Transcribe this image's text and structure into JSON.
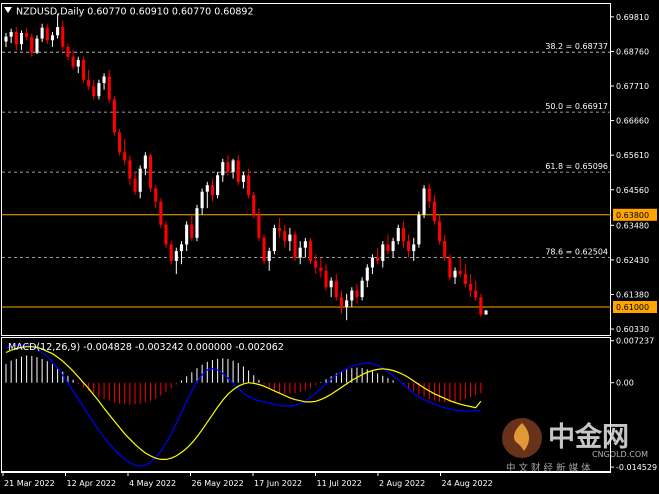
{
  "header": {
    "symbol_line": "NZDUSD,Daily  0.60770 0.60910 0.60770 0.60892",
    "icon": "collapse-triangle-icon"
  },
  "colors": {
    "background": "#000000",
    "bull": "#ffffff",
    "bear": "#ff0000",
    "level_line": "#ffa500",
    "grid": "#ffffff",
    "macd_hist_pos": "#ffffff",
    "macd_hist_neg": "#ff0000",
    "macd_main": "#0000ff",
    "macd_signal": "#ffff00"
  },
  "chart_data": [
    {
      "type": "candlestick",
      "title": "NZDUSD,Daily",
      "ohlc_last": {
        "open": 0.6077,
        "high": 0.6091,
        "low": 0.6077,
        "close": 0.60892
      },
      "ylim": [
        0.6015,
        0.702
      ],
      "y_ticks": [
        "0.69810",
        "0.68760",
        "0.67710",
        "0.66660",
        "0.65610",
        "0.64560",
        "0.63480",
        "0.62430",
        "0.61380",
        "0.60330"
      ],
      "x_ticks": [
        "21 Mar 2022",
        "12 Apr 2022",
        "4 May 2022",
        "26 May 2022",
        "17 Jun 2022",
        "11 Jul 2022",
        "2 Aug 2022",
        "24 Aug 2022"
      ],
      "fib_levels": [
        {
          "label": "38.2 = 0.68737",
          "value": 0.68737
        },
        {
          "label": "50.0 = 0.66917",
          "value": 0.66917
        },
        {
          "label": "61.8 = 0.65096",
          "value": 0.65096
        },
        {
          "label": "78.6 = 0.62504",
          "value": 0.62504
        }
      ],
      "price_levels": [
        {
          "label": "0.63800",
          "value": 0.638
        },
        {
          "label": "0.61000",
          "value": 0.61
        }
      ],
      "current_price_label": "0.60892",
      "candles": [
        [
          0.6906,
          0.6932,
          0.6889,
          0.6921
        ],
        [
          0.6921,
          0.6945,
          0.6901,
          0.6935
        ],
        [
          0.6935,
          0.695,
          0.688,
          0.6898
        ],
        [
          0.6898,
          0.694,
          0.688,
          0.6932
        ],
        [
          0.6932,
          0.6948,
          0.691,
          0.692
        ],
        [
          0.692,
          0.693,
          0.686,
          0.6872
        ],
        [
          0.6872,
          0.6925,
          0.6868,
          0.6915
        ],
        [
          0.6915,
          0.696,
          0.6905,
          0.6948
        ],
        [
          0.6948,
          0.6958,
          0.69,
          0.691
        ],
        [
          0.691,
          0.6935,
          0.689,
          0.6925
        ],
        [
          0.6925,
          0.699,
          0.6915,
          0.695
        ],
        [
          0.695,
          0.697,
          0.688,
          0.689
        ],
        [
          0.689,
          0.69,
          0.685,
          0.686
        ],
        [
          0.686,
          0.688,
          0.682,
          0.683
        ],
        [
          0.683,
          0.686,
          0.681,
          0.685
        ],
        [
          0.685,
          0.686,
          0.678,
          0.679
        ],
        [
          0.679,
          0.682,
          0.676,
          0.677
        ],
        [
          0.677,
          0.679,
          0.673,
          0.674
        ],
        [
          0.674,
          0.679,
          0.673,
          0.678
        ],
        [
          0.678,
          0.681,
          0.676,
          0.68
        ],
        [
          0.68,
          0.682,
          0.672,
          0.673
        ],
        [
          0.673,
          0.674,
          0.662,
          0.663
        ],
        [
          0.663,
          0.664,
          0.656,
          0.657
        ],
        [
          0.657,
          0.661,
          0.653,
          0.6545
        ],
        [
          0.6545,
          0.656,
          0.647,
          0.649
        ],
        [
          0.649,
          0.651,
          0.644,
          0.645
        ],
        [
          0.645,
          0.653,
          0.643,
          0.652
        ],
        [
          0.652,
          0.657,
          0.65,
          0.656
        ],
        [
          0.656,
          0.6565,
          0.645,
          0.646
        ],
        [
          0.646,
          0.647,
          0.64,
          0.642
        ],
        [
          0.642,
          0.643,
          0.634,
          0.635
        ],
        [
          0.635,
          0.636,
          0.628,
          0.629
        ],
        [
          0.629,
          0.63,
          0.623,
          0.624
        ],
        [
          0.624,
          0.628,
          0.62,
          0.627
        ],
        [
          0.627,
          0.63,
          0.623,
          0.629
        ],
        [
          0.629,
          0.636,
          0.627,
          0.635
        ],
        [
          0.635,
          0.638,
          0.63,
          0.631
        ],
        [
          0.631,
          0.641,
          0.63,
          0.64
        ],
        [
          0.64,
          0.646,
          0.638,
          0.645
        ],
        [
          0.645,
          0.648,
          0.64,
          0.647
        ],
        [
          0.647,
          0.649,
          0.642,
          0.644
        ],
        [
          0.644,
          0.651,
          0.643,
          0.65
        ],
        [
          0.65,
          0.655,
          0.648,
          0.654
        ],
        [
          0.654,
          0.656,
          0.65,
          0.651
        ],
        [
          0.651,
          0.655,
          0.649,
          0.6545
        ],
        [
          0.6545,
          0.656,
          0.647,
          0.648
        ],
        [
          0.648,
          0.651,
          0.646,
          0.65
        ],
        [
          0.65,
          0.652,
          0.643,
          0.644
        ],
        [
          0.644,
          0.645,
          0.637,
          0.638
        ],
        [
          0.638,
          0.64,
          0.63,
          0.631
        ],
        [
          0.631,
          0.632,
          0.623,
          0.624
        ],
        [
          0.624,
          0.628,
          0.621,
          0.627
        ],
        [
          0.627,
          0.635,
          0.626,
          0.634
        ],
        [
          0.634,
          0.637,
          0.631,
          0.633
        ],
        [
          0.633,
          0.635,
          0.628,
          0.63
        ],
        [
          0.63,
          0.634,
          0.627,
          0.632
        ],
        [
          0.632,
          0.633,
          0.624,
          0.625
        ],
        [
          0.625,
          0.63,
          0.623,
          0.628
        ],
        [
          0.628,
          0.631,
          0.625,
          0.63
        ],
        [
          0.63,
          0.631,
          0.623,
          0.624
        ],
        [
          0.624,
          0.626,
          0.62,
          0.622
        ],
        [
          0.622,
          0.625,
          0.619,
          0.621
        ],
        [
          0.621,
          0.623,
          0.615,
          0.616
        ],
        [
          0.616,
          0.619,
          0.613,
          0.618
        ],
        [
          0.618,
          0.62,
          0.612,
          0.613
        ],
        [
          0.613,
          0.615,
          0.608,
          0.61
        ],
        [
          0.61,
          0.614,
          0.606,
          0.612
        ],
        [
          0.612,
          0.616,
          0.61,
          0.615
        ],
        [
          0.615,
          0.617,
          0.611,
          0.613
        ],
        [
          0.613,
          0.619,
          0.612,
          0.618
        ],
        [
          0.618,
          0.623,
          0.616,
          0.622
        ],
        [
          0.622,
          0.626,
          0.62,
          0.625
        ],
        [
          0.625,
          0.628,
          0.623,
          0.624
        ],
        [
          0.624,
          0.63,
          0.622,
          0.629
        ],
        [
          0.629,
          0.632,
          0.626,
          0.627
        ],
        [
          0.627,
          0.631,
          0.625,
          0.63
        ],
        [
          0.63,
          0.635,
          0.629,
          0.634
        ],
        [
          0.634,
          0.636,
          0.628,
          0.63
        ],
        [
          0.63,
          0.632,
          0.625,
          0.627
        ],
        [
          0.627,
          0.631,
          0.624,
          0.629
        ],
        [
          0.629,
          0.639,
          0.628,
          0.638
        ],
        [
          0.638,
          0.647,
          0.637,
          0.646
        ],
        [
          0.646,
          0.6475,
          0.64,
          0.642
        ],
        [
          0.642,
          0.644,
          0.635,
          0.636
        ],
        [
          0.636,
          0.638,
          0.629,
          0.63
        ],
        [
          0.63,
          0.632,
          0.624,
          0.625
        ],
        [
          0.625,
          0.626,
          0.618,
          0.619
        ],
        [
          0.619,
          0.622,
          0.617,
          0.621
        ],
        [
          0.621,
          0.625,
          0.619,
          0.62
        ],
        [
          0.62,
          0.623,
          0.616,
          0.617
        ],
        [
          0.617,
          0.62,
          0.613,
          0.615
        ],
        [
          0.615,
          0.618,
          0.612,
          0.613
        ],
        [
          0.613,
          0.614,
          0.607,
          0.6077
        ],
        [
          0.6077,
          0.6091,
          0.6077,
          0.60892
        ]
      ]
    },
    {
      "type": "histogram+line",
      "title": "MACD(12,26,9)",
      "header_values": "MACD(12,26,9) -0.004828 -0.003242 0.000000 -0.002062",
      "ylim": [
        -0.0152,
        0.0077
      ],
      "y_ticks": [
        "0.007237",
        "0.00",
        "-0.014529"
      ],
      "histogram": [
        0.0032,
        0.0038,
        0.0041,
        0.0045,
        0.0047,
        0.0046,
        0.0044,
        0.0041,
        0.0037,
        0.0032,
        0.0026,
        0.0019,
        0.0012,
        0.0005,
        -0.0002,
        -0.0008,
        -0.0014,
        -0.0019,
        -0.0024,
        -0.0028,
        -0.0031,
        -0.0034,
        -0.0036,
        -0.0037,
        -0.0038,
        -0.0037,
        -0.0036,
        -0.0034,
        -0.0031,
        -0.0027,
        -0.0022,
        -0.0016,
        -0.001,
        -0.0003,
        0.0004,
        0.0011,
        0.0018,
        0.0025,
        0.0031,
        0.0036,
        0.0039,
        0.0041,
        0.0042,
        0.0041,
        0.0038,
        0.0034,
        0.0028,
        0.0021,
        0.0013,
        0.0005,
        -0.0003,
        -0.0009,
        -0.0014,
        -0.0017,
        -0.0019,
        -0.0019,
        -0.0018,
        -0.0016,
        -0.0013,
        -0.0009,
        -0.0004,
        0.0001,
        0.0006,
        0.0011,
        0.0016,
        0.002,
        0.0023,
        0.0025,
        0.0026,
        0.0025,
        0.0023,
        0.002,
        0.0016,
        0.0012,
        0.0008,
        0.0004,
        0.0,
        -0.0005,
        -0.001,
        -0.0015,
        -0.002,
        -0.0024,
        -0.0028,
        -0.0031,
        -0.0033,
        -0.0034,
        -0.0034,
        -0.0033,
        -0.0031,
        -0.0028,
        -0.0025,
        -0.0021,
        -0.0018
      ],
      "macd": [
        0.006,
        0.0062,
        0.0064,
        0.0065,
        0.0064,
        0.0062,
        0.0058,
        0.0052,
        0.0045,
        0.0036,
        0.0025,
        0.0013,
        0.0,
        -0.0014,
        -0.0028,
        -0.0042,
        -0.0056,
        -0.0069,
        -0.0082,
        -0.0094,
        -0.0105,
        -0.0115,
        -0.0124,
        -0.0132,
        -0.0138,
        -0.0142,
        -0.0144,
        -0.0142,
        -0.0137,
        -0.0129,
        -0.0118,
        -0.0104,
        -0.0088,
        -0.007,
        -0.0051,
        -0.0032,
        -0.0014,
        0.0002,
        0.0014,
        0.0022,
        0.0024,
        0.0022,
        0.0016,
        0.0008,
        -0.0001,
        -0.001,
        -0.0018,
        -0.0024,
        -0.0028,
        -0.0031,
        -0.0033,
        -0.0035,
        -0.0037,
        -0.0039,
        -0.004,
        -0.004,
        -0.0039,
        -0.0036,
        -0.0031,
        -0.0025,
        -0.0018,
        -0.001,
        -0.0002,
        0.0006,
        0.0013,
        0.0019,
        0.0024,
        0.0028,
        0.0031,
        0.0033,
        0.0034,
        0.0033,
        0.003,
        0.0025,
        0.0019,
        0.0012,
        0.0005,
        -0.0003,
        -0.0011,
        -0.0018,
        -0.0024,
        -0.0029,
        -0.0033,
        -0.0037,
        -0.004,
        -0.0043,
        -0.0045,
        -0.0047,
        -0.0048,
        -0.0049,
        -0.0049,
        -0.0048,
        -0.0048
      ],
      "signal": [
        0.0052,
        0.0056,
        0.0059,
        0.0061,
        0.0062,
        0.0062,
        0.0061,
        0.0058,
        0.0054,
        0.005,
        0.0044,
        0.0037,
        0.0029,
        0.002,
        0.001,
        0.0,
        -0.001,
        -0.0021,
        -0.0032,
        -0.0044,
        -0.0055,
        -0.0066,
        -0.0077,
        -0.0088,
        -0.0097,
        -0.0106,
        -0.0114,
        -0.0121,
        -0.0126,
        -0.013,
        -0.0132,
        -0.0132,
        -0.013,
        -0.0126,
        -0.012,
        -0.0113,
        -0.0104,
        -0.0093,
        -0.0081,
        -0.0068,
        -0.0055,
        -0.0042,
        -0.003,
        -0.002,
        -0.0012,
        -0.0006,
        -0.0002,
        0.0,
        -0.0001,
        -0.0003,
        -0.0006,
        -0.001,
        -0.0014,
        -0.0018,
        -0.0022,
        -0.0026,
        -0.0029,
        -0.0031,
        -0.0033,
        -0.0033,
        -0.0032,
        -0.0029,
        -0.0025,
        -0.002,
        -0.0014,
        -0.0008,
        -0.0002,
        0.0004,
        0.0009,
        0.0014,
        0.0018,
        0.0021,
        0.0023,
        0.0024,
        0.0023,
        0.0021,
        0.0018,
        0.0014,
        0.0009,
        0.0003,
        -0.0003,
        -0.0009,
        -0.0014,
        -0.0019,
        -0.0023,
        -0.0027,
        -0.0031,
        -0.0034,
        -0.0037,
        -0.0039,
        -0.0041,
        -0.0043,
        -0.0032
      ]
    }
  ],
  "watermark": {
    "brand": "中金网",
    "url": "CNGOLD.COM",
    "slogan": "中 文 财 经 新 媒 体"
  }
}
